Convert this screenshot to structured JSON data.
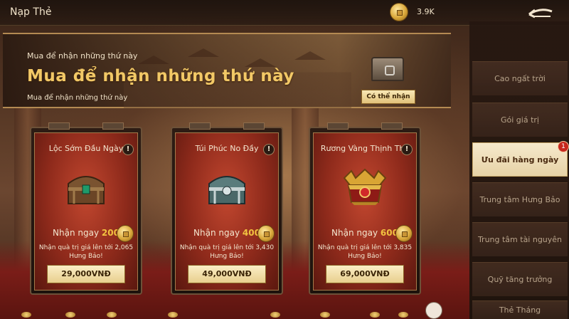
{
  "header": {
    "title": "Nạp Thẻ",
    "currency_icon": "gold-coin-icon",
    "currency_value": "3.9K",
    "back_icon": "back-arrow-icon"
  },
  "banner": {
    "subtitle": "Mua để nhận những thứ này",
    "title": "Mua để nhận những thứ này",
    "description": "Mua để nhận những thứ này",
    "claim_label": "Có thể nhận"
  },
  "sidebar": {
    "items": [
      {
        "label": "Cao ngất trời",
        "active": false
      },
      {
        "label": "Gói giá trị",
        "active": false
      },
      {
        "label": "Ưu đãi hàng ngày",
        "active": true,
        "badge": "1"
      },
      {
        "label": "Trung tâm Hưng Bảo",
        "active": false
      },
      {
        "label": "Trung tâm tài nguyên",
        "active": false
      },
      {
        "label": "Quỹ tăng trưởng",
        "active": false
      },
      {
        "label": "Thẻ Tháng",
        "active": false
      }
    ]
  },
  "packages": [
    {
      "name": "Lộc Sớm Đầu Ngày",
      "chest_icon": "wooden-chest-icon",
      "reward_label": "Nhận ngay",
      "reward_amount": "200",
      "description": "Nhận quà trị giá lên tới 2,065 Hưng Bảo!",
      "price": "29,000VNĐ"
    },
    {
      "name": "Túi Phúc No Đầy",
      "chest_icon": "silver-chest-icon",
      "reward_label": "Nhận ngay",
      "reward_amount": "400",
      "description": "Nhận quà trị giá lên tới 3,430 Hưng Bảo!",
      "price": "49,000VNĐ"
    },
    {
      "name": "Rương Vàng Thịnh Thế",
      "chest_icon": "golden-chest-icon",
      "reward_label": "Nhận ngay",
      "reward_amount": "600",
      "description": "Nhận quà trị giá lên tới 3,835 Hưng Bảo!",
      "price": "69,000VNĐ"
    }
  ],
  "colors": {
    "accent_gold": "#f2c866",
    "card_red": "#8e2a1b",
    "button_cream": "#fbeec6",
    "badge_red": "#c7281e"
  }
}
